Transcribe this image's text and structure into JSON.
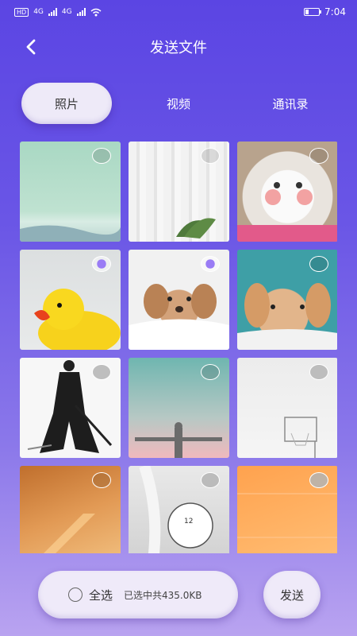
{
  "status": {
    "hd": "HD",
    "net1": "4G",
    "net2": "4G",
    "time": "7:04"
  },
  "header": {
    "title": "发送文件",
    "back_icon": "chevron-left-icon"
  },
  "tabs": [
    {
      "label": "照片",
      "active": true
    },
    {
      "label": "视频",
      "active": false
    },
    {
      "label": "通讯录",
      "active": false
    }
  ],
  "photos": [
    {
      "name": "beach-landscape",
      "check": "empty"
    },
    {
      "name": "curtain-plant",
      "check": "empty"
    },
    {
      "name": "white-cat",
      "check": "empty"
    },
    {
      "name": "rubber-duck",
      "check": "half"
    },
    {
      "name": "puppy-blanket",
      "check": "half"
    },
    {
      "name": "bunny",
      "check": "empty"
    },
    {
      "name": "ink-warrior",
      "check": "grey"
    },
    {
      "name": "christ-statue",
      "check": "empty"
    },
    {
      "name": "basketball-hoop",
      "check": "grey"
    },
    {
      "name": "orange-wall",
      "check": "empty"
    },
    {
      "name": "clock-fabric",
      "check": "grey"
    },
    {
      "name": "orange-gradient",
      "check": "grey"
    }
  ],
  "bottom": {
    "select_all_label": "全选",
    "selected_info": "已选中共435.0KB",
    "send_label": "发送"
  },
  "colors": {
    "bg_top": "#5b45e3",
    "bg_bottom": "#b9a3f0",
    "pill": "#eeeaf8"
  }
}
